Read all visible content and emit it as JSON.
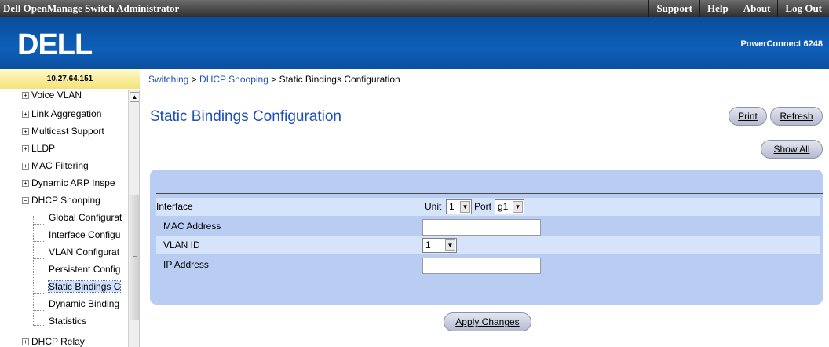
{
  "topbar": {
    "title": "Dell OpenManage Switch Administrator",
    "links": [
      "Support",
      "Help",
      "About",
      "Log Out"
    ]
  },
  "header": {
    "logo_text": "DELL",
    "model": "PowerConnect 6248"
  },
  "ip_address": "10.27.64.151",
  "breadcrumb": {
    "link1": "Switching",
    "sep1": " > ",
    "link2": "DHCP Snooping",
    "sep2": " > ",
    "current": "Static Bindings Configuration"
  },
  "sidebar": {
    "items": [
      {
        "label": "Voice VLAN",
        "expander": "+"
      },
      {
        "label": "Link Aggregation",
        "expander": "+"
      },
      {
        "label": "Multicast Support",
        "expander": "+"
      },
      {
        "label": "LLDP",
        "expander": "+"
      },
      {
        "label": "MAC Filtering",
        "expander": "+"
      },
      {
        "label": "Dynamic ARP Inspe",
        "expander": "+"
      },
      {
        "label": "DHCP Snooping",
        "expander": "−"
      },
      {
        "label": "Global Configurat"
      },
      {
        "label": "Interface Configu"
      },
      {
        "label": "VLAN Configurat"
      },
      {
        "label": "Persistent Config"
      },
      {
        "label": "Static Bindings C"
      },
      {
        "label": "Dynamic Binding"
      },
      {
        "label": "Statistics"
      },
      {
        "label": "DHCP Relay",
        "expander": "+"
      }
    ]
  },
  "main": {
    "title": "Static Bindings Configuration",
    "print_label": "Print",
    "refresh_label": "Refresh",
    "show_all_label": "Show All",
    "apply_label": "Apply Changes",
    "form": {
      "interface_label": "Interface",
      "unit_label": "Unit",
      "unit_value": "1",
      "port_label": "Port",
      "port_value": "g1",
      "mac_label": "MAC Address",
      "mac_value": "",
      "vlan_label": "VLAN ID",
      "vlan_value": "1",
      "ip_label": "IP Address",
      "ip_value": ""
    }
  },
  "colors": {
    "header_blue": "#0e5fb8",
    "panel_blue": "#b9cdf2",
    "title_blue": "#1d4fb8",
    "ip_bar_yellow": "#f4e27a"
  }
}
